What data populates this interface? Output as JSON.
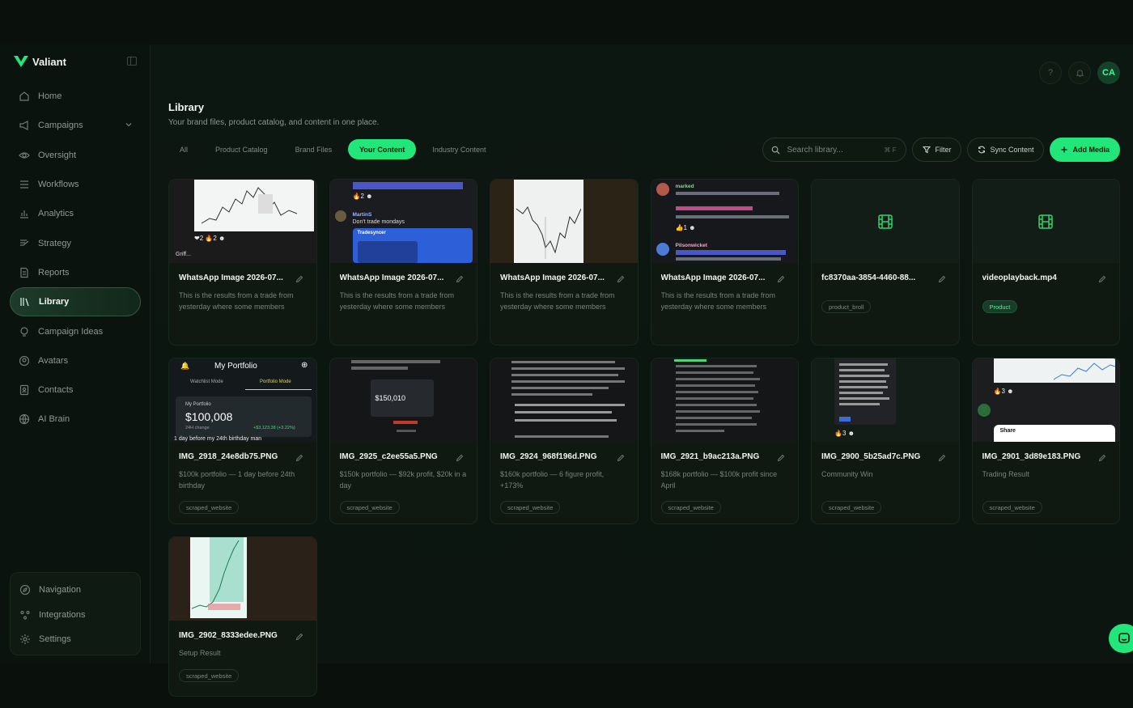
{
  "brand": {
    "name": "Valiant"
  },
  "sidebar": {
    "items": [
      {
        "label": "Home",
        "icon": "home-icon"
      },
      {
        "label": "Campaigns",
        "icon": "megaphone-icon"
      },
      {
        "label": "Oversight",
        "icon": "eye-icon"
      },
      {
        "label": "Workflows",
        "icon": "list-icon"
      },
      {
        "label": "Analytics",
        "icon": "bar-chart-icon"
      },
      {
        "label": "Strategy",
        "icon": "strategy-icon"
      },
      {
        "label": "Reports",
        "icon": "report-icon"
      },
      {
        "label": "Library",
        "icon": "library-icon"
      },
      {
        "label": "Campaign Ideas",
        "icon": "lightbulb-icon"
      },
      {
        "label": "Avatars",
        "icon": "avatar-icon"
      },
      {
        "label": "Contacts",
        "icon": "contacts-icon"
      },
      {
        "label": "AI Brain",
        "icon": "globe-icon"
      }
    ],
    "bottom": [
      {
        "label": "Navigation",
        "icon": "compass-icon"
      },
      {
        "label": "Integrations",
        "icon": "integrations-icon"
      },
      {
        "label": "Settings",
        "icon": "gear-icon"
      }
    ]
  },
  "header": {
    "avatar_initials": "CA",
    "help": "?"
  },
  "page": {
    "title": "Library",
    "subtitle": "Your brand files, product catalog, and content in one place."
  },
  "tabs": [
    "All",
    "Product Catalog",
    "Brand Files",
    "Your Content",
    "Industry Content"
  ],
  "toolbar": {
    "search_placeholder": "Search library...",
    "search_shortcut": "⌘ F",
    "filter": "Filter",
    "sync": "Sync Content",
    "add": "Add Media"
  },
  "cards": [
    {
      "title": "WhatsApp Image 2026-07...",
      "desc": "This is the results from a trade from yesterday where some members mad...",
      "tag": ""
    },
    {
      "title": "WhatsApp Image 2026-07...",
      "desc": "This is the results from a trade from yesterday where some members mad...",
      "tag": ""
    },
    {
      "title": "WhatsApp Image 2026-07...",
      "desc": "This is the results from a trade from yesterday where some members mad...",
      "tag": ""
    },
    {
      "title": "WhatsApp Image 2026-07...",
      "desc": "This is the results from a trade from yesterday where some members mad...",
      "tag": ""
    },
    {
      "title": "fc8370aa-3854-4460-88...",
      "desc": "",
      "tag": "product_broll"
    },
    {
      "title": "videoplayback.mp4",
      "desc": "",
      "tag": "Product"
    },
    {
      "title": "IMG_2918_24e8db75.PNG",
      "desc": "$100k portfolio — 1 day before 24th birthday",
      "tag": "scraped_website"
    },
    {
      "title": "IMG_2925_c2ee55a5.PNG",
      "desc": "$150k portfolio — $92k profit, $20k in a day",
      "tag": "scraped_website"
    },
    {
      "title": "IMG_2924_968f196d.PNG",
      "desc": "$160k portfolio — 6 figure profit, +173%",
      "tag": "scraped_website"
    },
    {
      "title": "IMG_2921_b9ac213a.PNG",
      "desc": "$168k portfolio — $100k profit since April",
      "tag": "scraped_website"
    },
    {
      "title": "IMG_2900_5b25ad7c.PNG",
      "desc": "Community Win",
      "tag": "scraped_website"
    },
    {
      "title": "IMG_2901_3d89e183.PNG",
      "desc": "Trading Result",
      "tag": "scraped_website"
    },
    {
      "title": "IMG_2902_8333edee.PNG",
      "desc": "Setup Result",
      "tag": "scraped_website"
    }
  ],
  "thumbs": {
    "portfolio_title": "My Portfolio",
    "watchlist": "Watchlist Mode",
    "portfolio_mode": "Portfolio Mode",
    "my_portfolio": "My Portfolio",
    "value": "$100,008",
    "change_label": "24H change",
    "change": "+$3,123.38 (+3.22%)",
    "caption": "1 day before my 24th birthday man",
    "value2": "$150,010",
    "martin": "MartinS",
    "dont_trade": "Don't trade mondays",
    "tradesyncer": "Tradesyncer",
    "marked": "marked",
    "pilsonwicket": "Pilsonwicket",
    "share": "Share",
    "griff": "Griff..."
  },
  "colors": {
    "accent": "#22e67a",
    "bg": "#0c1510"
  }
}
